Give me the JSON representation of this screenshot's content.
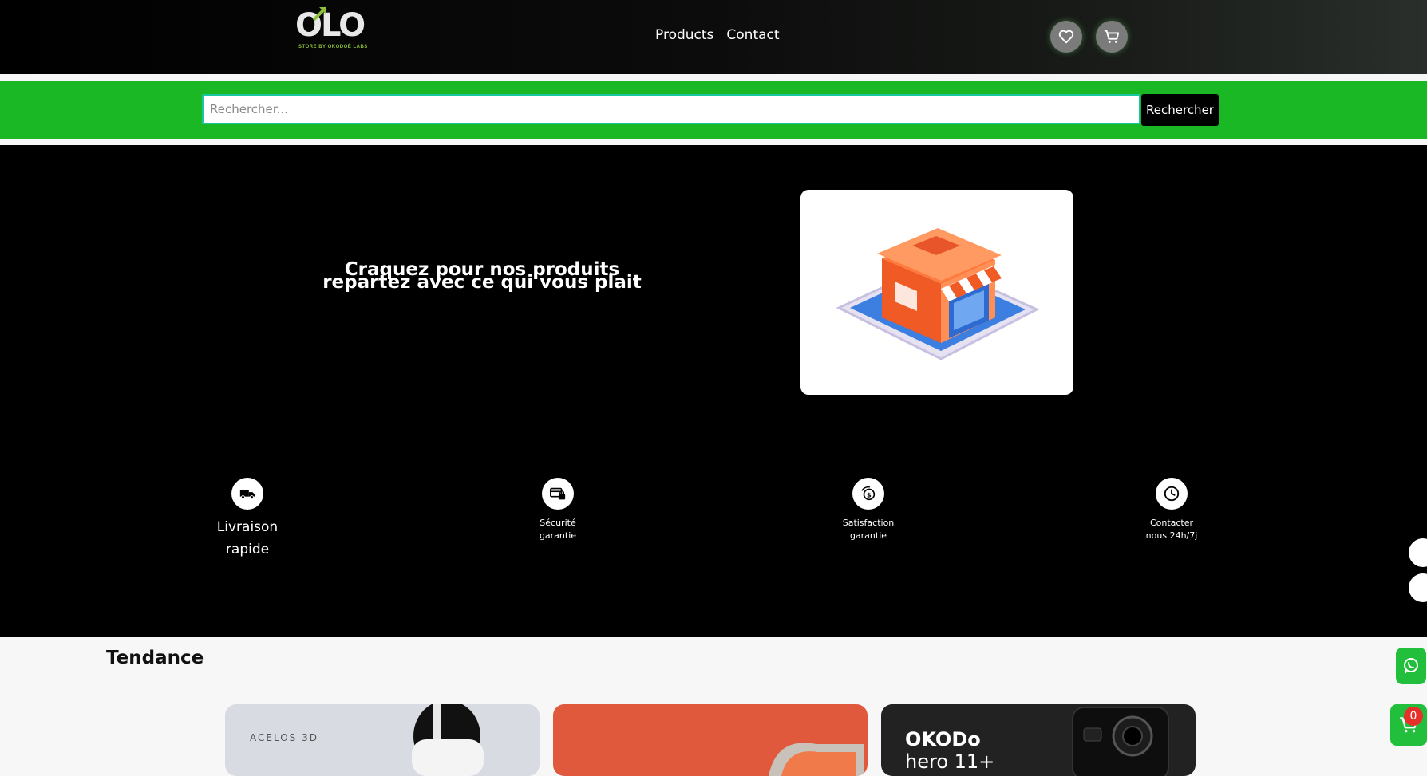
{
  "header": {
    "logo": {
      "text": "OLO",
      "tagline": "STORE BY OKODOÉ LABS"
    },
    "nav": [
      "Products",
      "Contact"
    ],
    "icons": [
      "heart-icon",
      "cart-icon"
    ]
  },
  "search": {
    "placeholder": "Rechercher...",
    "button_label": "Rechercher"
  },
  "hero": {
    "title_line1": "Craquez pour nos produits",
    "title_line2": "repartez avec ce qui vous plait",
    "image": "shop-on-tablet-illustration"
  },
  "features": [
    {
      "icon": "truck-icon",
      "line1": "Livraison",
      "line2": "rapide"
    },
    {
      "icon": "secure-payment-icon",
      "line1": "Sécurité",
      "line2": "garantie"
    },
    {
      "icon": "satisfaction-coin-icon",
      "line1": "Satisfaction",
      "line2": "garantie"
    },
    {
      "icon": "clock-icon",
      "line1": "Contacter",
      "line2": "nous 24h/7j"
    }
  ],
  "trending": {
    "title": "Tendance",
    "cards": [
      {
        "brand": "ACELOS 3D",
        "image": "vr-headset"
      },
      {
        "brand": "",
        "image": "massage-chair"
      },
      {
        "brand": "OKODo",
        "model": "hero 11+",
        "image": "action-camera"
      }
    ]
  },
  "floating": {
    "whatsapp_icon": "whatsapp-icon",
    "cart_count": "0"
  },
  "colors": {
    "accent_green": "#1ab824",
    "search_border": "#18c7a0",
    "badge_red": "#e8302a"
  }
}
